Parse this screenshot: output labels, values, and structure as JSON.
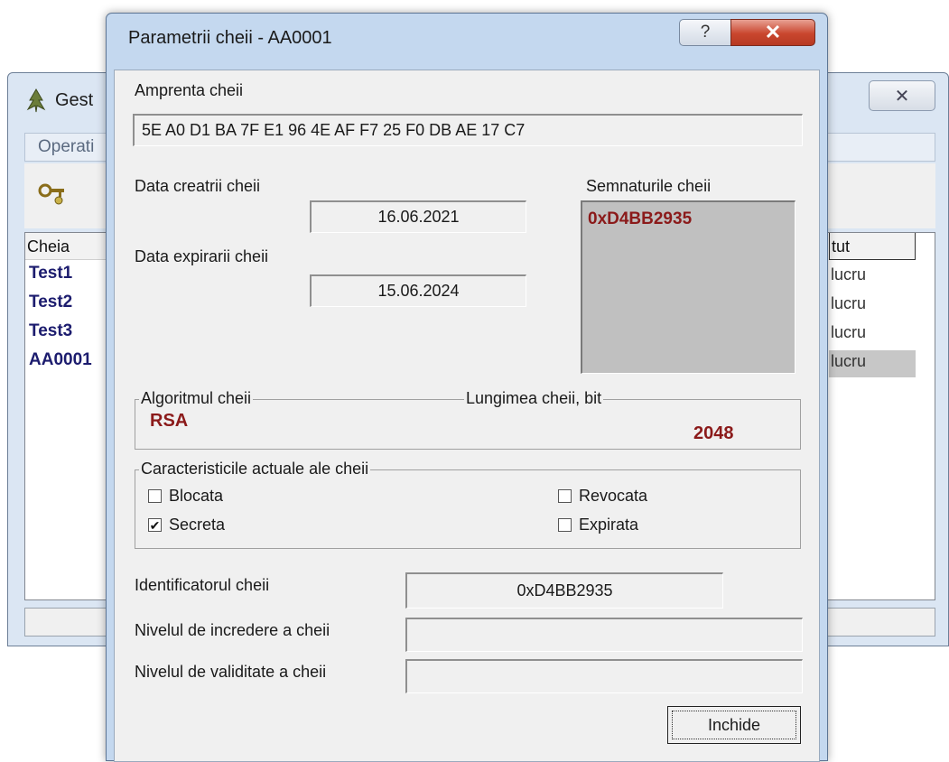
{
  "background_window": {
    "title": "Gest",
    "menu": "Operati",
    "columns": {
      "key": "Cheia",
      "status": "tut"
    },
    "rows": [
      {
        "name": "Test1",
        "status": "lucru"
      },
      {
        "name": "Test2",
        "status": "lucru"
      },
      {
        "name": "Test3",
        "status": "lucru"
      },
      {
        "name": "AA0001",
        "status": "lucru"
      }
    ]
  },
  "dialog": {
    "title": "Parametrii cheii - AA0001",
    "help_glyph": "?",
    "close_glyph": "✕",
    "fingerprint_label": "Amprenta cheii",
    "fingerprint_value": "5E A0 D1 BA 7F E1 96 4E AF F7 25 F0 DB AE 17 C7",
    "created_label": "Data creatrii cheii",
    "created_value": "16.06.2021",
    "expiry_label": "Data expirarii cheii",
    "expiry_value": "15.06.2024",
    "signatures_label": "Semnaturile cheii",
    "signatures": [
      "0xD4BB2935"
    ],
    "algorithm_label": "Algoritmul cheii",
    "algorithm_value": "RSA",
    "length_label": "Lungimea cheii, bit",
    "length_value": "2048",
    "characteristics_label": "Caracteristicile actuale ale cheii",
    "checkboxes": {
      "blocked": {
        "label": "Blocata",
        "checked": false
      },
      "secret": {
        "label": "Secreta",
        "checked": true
      },
      "revoked": {
        "label": "Revocata",
        "checked": false
      },
      "expired": {
        "label": "Expirata",
        "checked": false
      }
    },
    "identifier_label": "Identificatorul cheii",
    "identifier_value": "0xD4BB2935",
    "trust_label": "Nivelul de incredere a cheii",
    "trust_value": "",
    "validity_label": "Nivelul de validitate a cheii",
    "validity_value": "",
    "close_button": "Inchide"
  },
  "colors": {
    "accent_red": "#8b1a1a",
    "list_name_blue": "#1c1c6e",
    "signature_bg": "#c0c0c0"
  }
}
